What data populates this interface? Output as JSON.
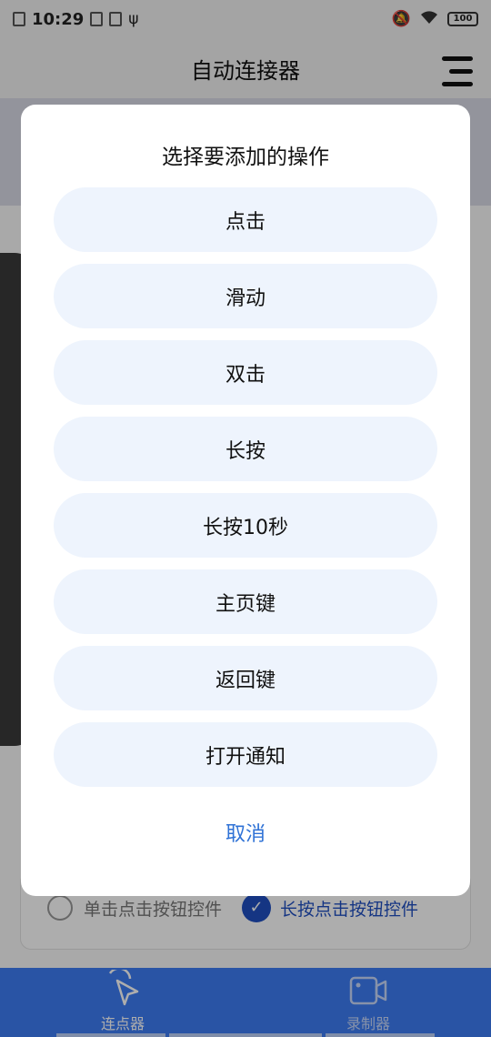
{
  "status_bar": {
    "time": "10:29",
    "battery": "100"
  },
  "app": {
    "title": "自动连接器"
  },
  "background": {
    "radio_option_1": "单击点击按钮控件",
    "radio_option_2": "长按点击按钮控件",
    "selected_option": "长按点击按钮控件"
  },
  "bottom_nav": {
    "items": [
      {
        "label": "连点器",
        "icon": "cursor-click-icon",
        "active": true
      },
      {
        "label": "录制器",
        "icon": "video-camera-icon",
        "active": false
      }
    ]
  },
  "dialog": {
    "title": "选择要添加的操作",
    "options": [
      "点击",
      "滑动",
      "双击",
      "长按",
      "长按10秒",
      "主页键",
      "返回键",
      "打开通知"
    ],
    "cancel": "取消"
  },
  "colors": {
    "accent": "#3d7cf3",
    "cancel_text": "#2f72d6",
    "option_bg": "#eef4fd",
    "selected_radio": "#1f4fc2"
  }
}
